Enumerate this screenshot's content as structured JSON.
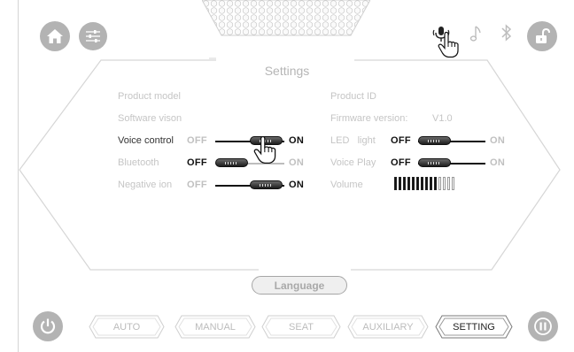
{
  "header": {
    "home_icon": "house-icon",
    "equalizer_icon": "sliders-icon",
    "voice_icon": "microphone-icon",
    "music_icon": "music-note-icon",
    "bluetooth_icon": "bluetooth-icon",
    "lock_icon": "unlock-icon"
  },
  "settings": {
    "title": "Settings",
    "left": {
      "product_model": "Product model",
      "software": "Software vison",
      "voice_control": {
        "label": "Voice control",
        "off": "OFF",
        "on": "ON",
        "state": "on"
      },
      "bluetooth": {
        "label": "Bluetooth",
        "off": "OFF",
        "on": "ON",
        "state": "off"
      },
      "negative_ion": {
        "label": "Negative ion",
        "off": "OFF",
        "on": "ON",
        "state": "on"
      }
    },
    "right": {
      "product_id": "Product ID",
      "firmware_label": "Firmware version:",
      "firmware_value": "V1.0",
      "led_light": {
        "label": "LED   light",
        "off": "OFF",
        "on": "ON",
        "state": "off"
      },
      "voice_play": {
        "label": "Voice Play",
        "off": "OFF",
        "on": "ON",
        "state": "off"
      },
      "volume": {
        "label": "Volume",
        "level": 10,
        "max": 14
      }
    },
    "language_button": "Language"
  },
  "footer": {
    "power_icon": "power-icon",
    "pause_icon": "pause-icon",
    "tabs": [
      {
        "label": "AUTO",
        "active": false
      },
      {
        "label": "MANUAL",
        "active": false
      },
      {
        "label": "SEAT",
        "active": false
      },
      {
        "label": "AUXILIARY",
        "active": false
      },
      {
        "label": "SETTING",
        "active": true
      }
    ]
  },
  "colors": {
    "accent_dark": "#111111",
    "muted": "#c5c5c5",
    "button_gray": "#b3b3b3"
  }
}
